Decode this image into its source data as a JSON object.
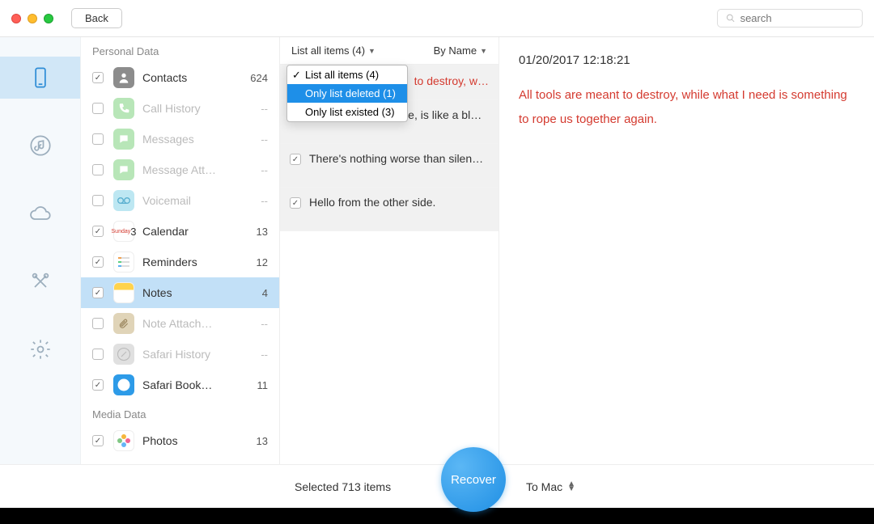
{
  "titlebar": {
    "back": "Back",
    "search_placeholder": "search"
  },
  "navrail": {
    "items": [
      "device",
      "music",
      "cloud",
      "tools",
      "settings"
    ],
    "selected": 0
  },
  "categories": {
    "sections": [
      {
        "header": "Personal Data",
        "items": [
          {
            "label": "Contacts",
            "count": "624",
            "checked": true,
            "enabled": true,
            "selected": false,
            "icon": "ic-contacts"
          },
          {
            "label": "Call History",
            "count": "--",
            "checked": false,
            "enabled": false,
            "selected": false,
            "icon": "ic-call"
          },
          {
            "label": "Messages",
            "count": "--",
            "checked": false,
            "enabled": false,
            "selected": false,
            "icon": "ic-msg"
          },
          {
            "label": "Message Att…",
            "count": "--",
            "checked": false,
            "enabled": false,
            "selected": false,
            "icon": "ic-msgatt"
          },
          {
            "label": "Voicemail",
            "count": "--",
            "checked": false,
            "enabled": false,
            "selected": false,
            "icon": "ic-vm"
          },
          {
            "label": "Calendar",
            "count": "13",
            "checked": true,
            "enabled": true,
            "selected": false,
            "icon": "ic-cal"
          },
          {
            "label": "Reminders",
            "count": "12",
            "checked": true,
            "enabled": true,
            "selected": false,
            "icon": "ic-rem"
          },
          {
            "label": "Notes",
            "count": "4",
            "checked": true,
            "enabled": true,
            "selected": true,
            "icon": "ic-notes"
          },
          {
            "label": "Note Attach…",
            "count": "--",
            "checked": false,
            "enabled": false,
            "selected": false,
            "icon": "ic-noteatt"
          },
          {
            "label": "Safari History",
            "count": "--",
            "checked": false,
            "enabled": false,
            "selected": false,
            "icon": "ic-safari"
          },
          {
            "label": "Safari Book…",
            "count": "11",
            "checked": true,
            "enabled": true,
            "selected": false,
            "icon": "ic-safbk"
          }
        ]
      },
      {
        "header": "Media Data",
        "items": [
          {
            "label": "Photos",
            "count": "13",
            "checked": true,
            "enabled": true,
            "selected": false,
            "icon": "ic-photos"
          }
        ]
      }
    ]
  },
  "listcol": {
    "filter_label": "List all items (4)",
    "sort_label": "By Name",
    "dropdown": [
      {
        "label": "List all items (4)",
        "checked": true,
        "hl": false
      },
      {
        "label": "Only list deleted (1)",
        "checked": false,
        "hl": true
      },
      {
        "label": "Only list existed (3)",
        "checked": false,
        "hl": false
      }
    ],
    "rows": [
      {
        "text": "to destroy, w…",
        "checked": true,
        "deleted": true,
        "behind_dd": true
      },
      {
        "text": "Normal, in our house, is like a bl…",
        "checked": true,
        "deleted": false
      },
      {
        "text": "There's nothing worse than silen…",
        "checked": true,
        "deleted": false
      },
      {
        "text": "Hello from the other side.",
        "checked": true,
        "deleted": false
      }
    ]
  },
  "detail": {
    "date": "01/20/2017 12:18:21",
    "body": "All tools are meant to destroy, while what I need is something to rope us together again."
  },
  "footer": {
    "selected_text": "Selected 713 items",
    "recover": "Recover",
    "dest": "To Mac"
  }
}
